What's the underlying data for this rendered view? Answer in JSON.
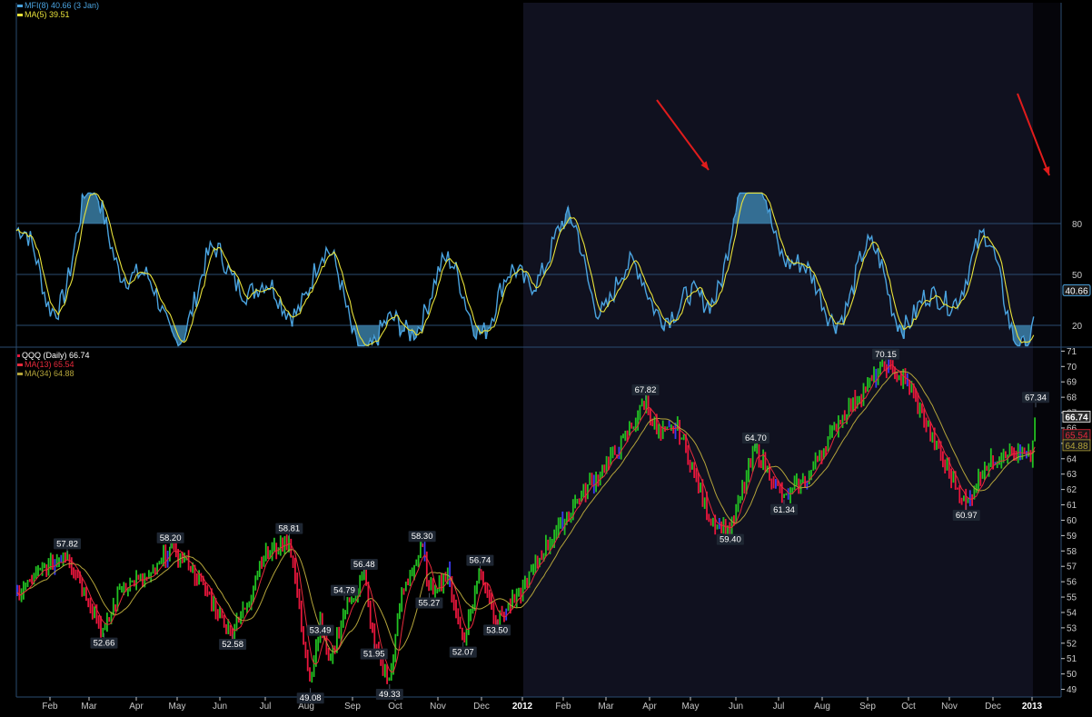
{
  "colors": {
    "background": "#000000",
    "shaded_region": "#10111f",
    "grid": "#2a4c70",
    "mfi_line": "#4aa3df",
    "mfi_fill": "#3e86b0",
    "mfi_ma_line": "#e8e23a",
    "price_up": "#22c022",
    "price_down": "#e8163c",
    "price_neutral": "#3a3af0",
    "ma13_line": "#e82a3c",
    "ma34_line": "#b4a43a",
    "axis_text": "#c8c8c8",
    "annotation_arrow": "#e01c1c",
    "frame": "#d01818"
  },
  "top_panel": {
    "legend": {
      "mfi": "MFI(8) 40.66 (3 Jan)",
      "ma": "MA(5) 39.51"
    },
    "y_ticks": [
      "80",
      "50",
      "20"
    ],
    "current_value_label": "40.66",
    "annotations": [
      "red-arrow-down-1",
      "red-arrow-down-2"
    ]
  },
  "bottom_panel": {
    "legend": {
      "price": "QQQ (Daily) 66.74",
      "ma13": "MA(13) 65.54",
      "ma34": "MA(34) 64.88"
    },
    "y_ticks": [
      "71",
      "70",
      "69",
      "68",
      "67",
      "66",
      "65",
      "64",
      "63",
      "62",
      "61",
      "60",
      "59",
      "58",
      "57",
      "56",
      "55",
      "54",
      "53",
      "52",
      "51",
      "50",
      "49"
    ],
    "current_labels": {
      "price": "66.74",
      "ma13": "65.54",
      "ma34": "64.88"
    }
  },
  "x_axis": {
    "labels": [
      "Feb",
      "Mar",
      "Apr",
      "May",
      "Jun",
      "Jul",
      "Aug",
      "Sep",
      "Oct",
      "Nov",
      "Dec",
      "2012",
      "Feb",
      "Mar",
      "Apr",
      "May",
      "Jun",
      "Jul",
      "Aug",
      "Sep",
      "Oct",
      "Nov",
      "Dec",
      "2013"
    ]
  },
  "chart_data": [
    {
      "type": "line",
      "title": "MFI(8) 40.66 (3 Jan)",
      "ylim": [
        0,
        100
      ],
      "y_ticks": [
        20,
        50,
        80
      ],
      "series": [
        {
          "name": "MFI(8)",
          "last_value": 40.66
        },
        {
          "name": "MA(5)",
          "last_value": 39.51
        }
      ],
      "mfi_anchors": [
        [
          0,
          65
        ],
        [
          0.03,
          50
        ],
        [
          0.07,
          83
        ],
        [
          0.1,
          55
        ],
        [
          0.14,
          40
        ],
        [
          0.18,
          28
        ],
        [
          0.22,
          55
        ],
        [
          0.26,
          40
        ],
        [
          0.28,
          43
        ],
        [
          0.32,
          30
        ],
        [
          0.38,
          18
        ],
        [
          0.45,
          45
        ],
        [
          0.5,
          38
        ],
        [
          0.55,
          75
        ],
        [
          0.6,
          35
        ],
        [
          0.65,
          24
        ],
        [
          0.72,
          98
        ],
        [
          0.78,
          50
        ],
        [
          0.82,
          30
        ],
        [
          0.85,
          45
        ],
        [
          0.9,
          35
        ],
        [
          0.95,
          48
        ],
        [
          1,
          30
        ]
      ],
      "mfi_hi": [
        [
          0.14,
          21,
          25,
          32
        ],
        [
          0.32,
          23,
          30,
          55
        ]
      ]
    },
    {
      "type": "bar",
      "title": "QQQ (Daily) 66.74",
      "ylim": [
        48.5,
        71.2
      ],
      "x_range": [
        "2011-01-13",
        "2013-01-03"
      ],
      "series": [
        {
          "name": "QQQ (Daily)",
          "last_value": 66.74
        },
        {
          "name": "MA(13)",
          "last_value": 65.54
        },
        {
          "name": "MA(34)",
          "last_value": 64.88
        }
      ],
      "price_anchors": [
        [
          "2011-01-13",
          55.0
        ],
        [
          "2011-01-28",
          56.5
        ],
        [
          "2011-02-18",
          57.82
        ],
        [
          "2011-03-16",
          52.66
        ],
        [
          "2011-03-28",
          55.8
        ],
        [
          "2011-04-18",
          56.2
        ],
        [
          "2011-05-02",
          58.2
        ],
        [
          "2011-05-16",
          57.0
        ],
        [
          "2011-06-15",
          52.58
        ],
        [
          "2011-06-27",
          55.0
        ],
        [
          "2011-07-05",
          57.5
        ],
        [
          "2011-07-25",
          58.81
        ],
        [
          "2011-08-09",
          49.08
        ],
        [
          "2011-08-16",
          53.49
        ],
        [
          "2011-08-22",
          50.5
        ],
        [
          "2011-09-02",
          54.0
        ],
        [
          "2011-09-16",
          56.48
        ],
        [
          "2011-09-23",
          51.95
        ],
        [
          "2011-10-04",
          49.33
        ],
        [
          "2011-10-12",
          55.0
        ],
        [
          "2011-10-27",
          58.3
        ],
        [
          "2011-11-01",
          55.27
        ],
        [
          "2011-11-14",
          56.5
        ],
        [
          "2011-11-25",
          52.07
        ],
        [
          "2011-12-07",
          56.74
        ],
        [
          "2011-12-19",
          53.5
        ],
        [
          "2012-01-03",
          55.0
        ],
        [
          "2012-01-24",
          58.5
        ],
        [
          "2012-02-15",
          61.5
        ],
        [
          "2012-03-09",
          64.0
        ],
        [
          "2012-03-26",
          66.5
        ],
        [
          "2012-04-02",
          67.82
        ],
        [
          "2012-04-11",
          65.5
        ],
        [
          "2012-04-25",
          66.0
        ],
        [
          "2012-05-18",
          60.0
        ],
        [
          "2012-06-01",
          59.4
        ],
        [
          "2012-06-19",
          64.7
        ],
        [
          "2012-07-09",
          61.34
        ],
        [
          "2012-07-27",
          63.0
        ],
        [
          "2012-08-17",
          66.5
        ],
        [
          "2012-09-19",
          70.15
        ],
        [
          "2012-10-05",
          68.8
        ],
        [
          "2012-10-26",
          64.5
        ],
        [
          "2012-11-15",
          60.97
        ],
        [
          "2012-11-28",
          63.5
        ],
        [
          "2012-12-13",
          64.5
        ],
        [
          "2012-12-31",
          64.0
        ],
        [
          "2013-01-03",
          67.34
        ]
      ],
      "annotations": [
        {
          "date": "2011-02-18",
          "value": 57.82,
          "text": "57.82",
          "pos": "above"
        },
        {
          "date": "2011-03-16",
          "value": 52.66,
          "text": "52.66",
          "pos": "below"
        },
        {
          "date": "2011-05-02",
          "value": 58.2,
          "text": "58.20",
          "pos": "above"
        },
        {
          "date": "2011-06-15",
          "value": 52.58,
          "text": "52.58",
          "pos": "below"
        },
        {
          "date": "2011-07-25",
          "value": 58.81,
          "text": "58.81",
          "pos": "above"
        },
        {
          "date": "2011-08-09",
          "value": 49.08,
          "text": "49.08",
          "pos": "below"
        },
        {
          "date": "2011-08-16",
          "value": 53.49,
          "text": "53.49",
          "pos": "below"
        },
        {
          "date": "2011-09-02",
          "value": 54.79,
          "text": "54.79",
          "pos": "above"
        },
        {
          "date": "2011-09-16",
          "value": 56.48,
          "text": "56.48",
          "pos": "above"
        },
        {
          "date": "2011-09-23",
          "value": 51.95,
          "text": "51.95",
          "pos": "below"
        },
        {
          "date": "2011-10-04",
          "value": 49.33,
          "text": "49.33",
          "pos": "below"
        },
        {
          "date": "2011-10-27",
          "value": 58.3,
          "text": "58.30",
          "pos": "above"
        },
        {
          "date": "2011-11-01",
          "value": 55.27,
          "text": "55.27",
          "pos": "below"
        },
        {
          "date": "2011-11-25",
          "value": 52.07,
          "text": "52.07",
          "pos": "below"
        },
        {
          "date": "2011-12-07",
          "value": 56.74,
          "text": "56.74",
          "pos": "above"
        },
        {
          "date": "2011-12-19",
          "value": 53.5,
          "text": "53.50",
          "pos": "below"
        },
        {
          "date": "2012-04-02",
          "value": 67.82,
          "text": "67.82",
          "pos": "above"
        },
        {
          "date": "2012-06-01",
          "value": 59.4,
          "text": "59.40",
          "pos": "below"
        },
        {
          "date": "2012-06-19",
          "value": 64.7,
          "text": "64.70",
          "pos": "above"
        },
        {
          "date": "2012-07-09",
          "value": 61.34,
          "text": "61.34",
          "pos": "below"
        },
        {
          "date": "2012-09-19",
          "value": 70.15,
          "text": "70.15",
          "pos": "above"
        },
        {
          "date": "2012-11-15",
          "value": 60.97,
          "text": "60.97",
          "pos": "below"
        },
        {
          "date": "2013-01-03",
          "value": 67.34,
          "text": "67.34",
          "pos": "above"
        }
      ]
    }
  ]
}
